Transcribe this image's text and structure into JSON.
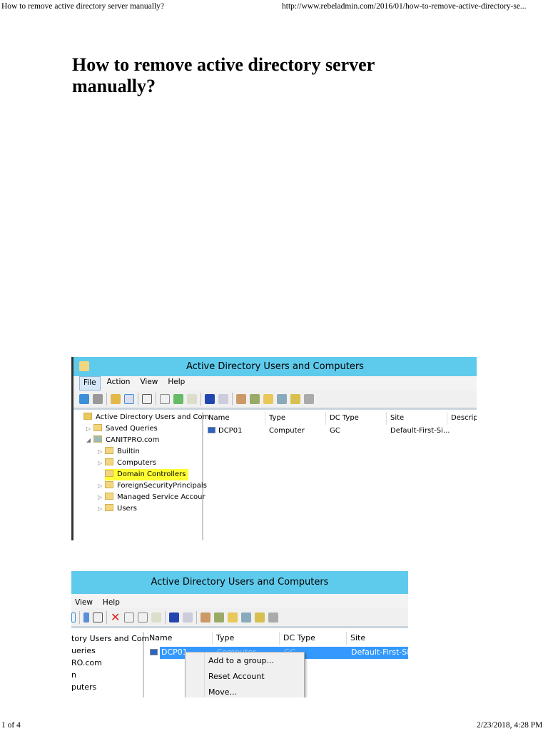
{
  "header": {
    "title": "How to remove active directory server manually?",
    "url": "http://www.rebeladmin.com/2016/01/how-to-remove-active-directory-se..."
  },
  "article": {
    "title": "How to remove active directory server manually?"
  },
  "shot1": {
    "window_title": "Active Directory Users and Computers",
    "menu": [
      "File",
      "Action",
      "View",
      "Help"
    ],
    "tree": [
      {
        "label": "Active Directory Users and Com"
      },
      {
        "label": "Saved Queries"
      },
      {
        "label": "CANITPRO.com"
      },
      {
        "label": "Builtin"
      },
      {
        "label": "Computers"
      },
      {
        "label": "Domain Controllers",
        "highlighted": true
      },
      {
        "label": "ForeignSecurityPrincipals"
      },
      {
        "label": "Managed Service Accour"
      },
      {
        "label": "Users"
      }
    ],
    "columns": [
      "Name",
      "Type",
      "DC Type",
      "Site",
      "Descrip"
    ],
    "rows": [
      {
        "name": "DCP01",
        "type": "Computer",
        "dc_type": "GC",
        "site": "Default-First-Si..."
      }
    ]
  },
  "shot2": {
    "window_title": "Active Directory Users and Computers",
    "menu": [
      "View",
      "Help"
    ],
    "tree": [
      "tory Users and Com",
      "ueries",
      "RO.com",
      "n",
      "puters"
    ],
    "columns": [
      "Name",
      "Type",
      "DC Type",
      "Site"
    ],
    "rows": [
      {
        "name": "DCP01",
        "type": "Computer",
        "dc_type": "GC",
        "site": "Default-First-Si..."
      }
    ],
    "context_menu": [
      "Add to a group...",
      "Reset Account",
      "Move..."
    ]
  },
  "footer": {
    "page": "1 of 4",
    "datetime": "2/23/2018, 4:28 PM"
  },
  "colors": {
    "titlebar": "#5fcbec",
    "highlight": "#ffff33",
    "selection": "#3399ff"
  }
}
